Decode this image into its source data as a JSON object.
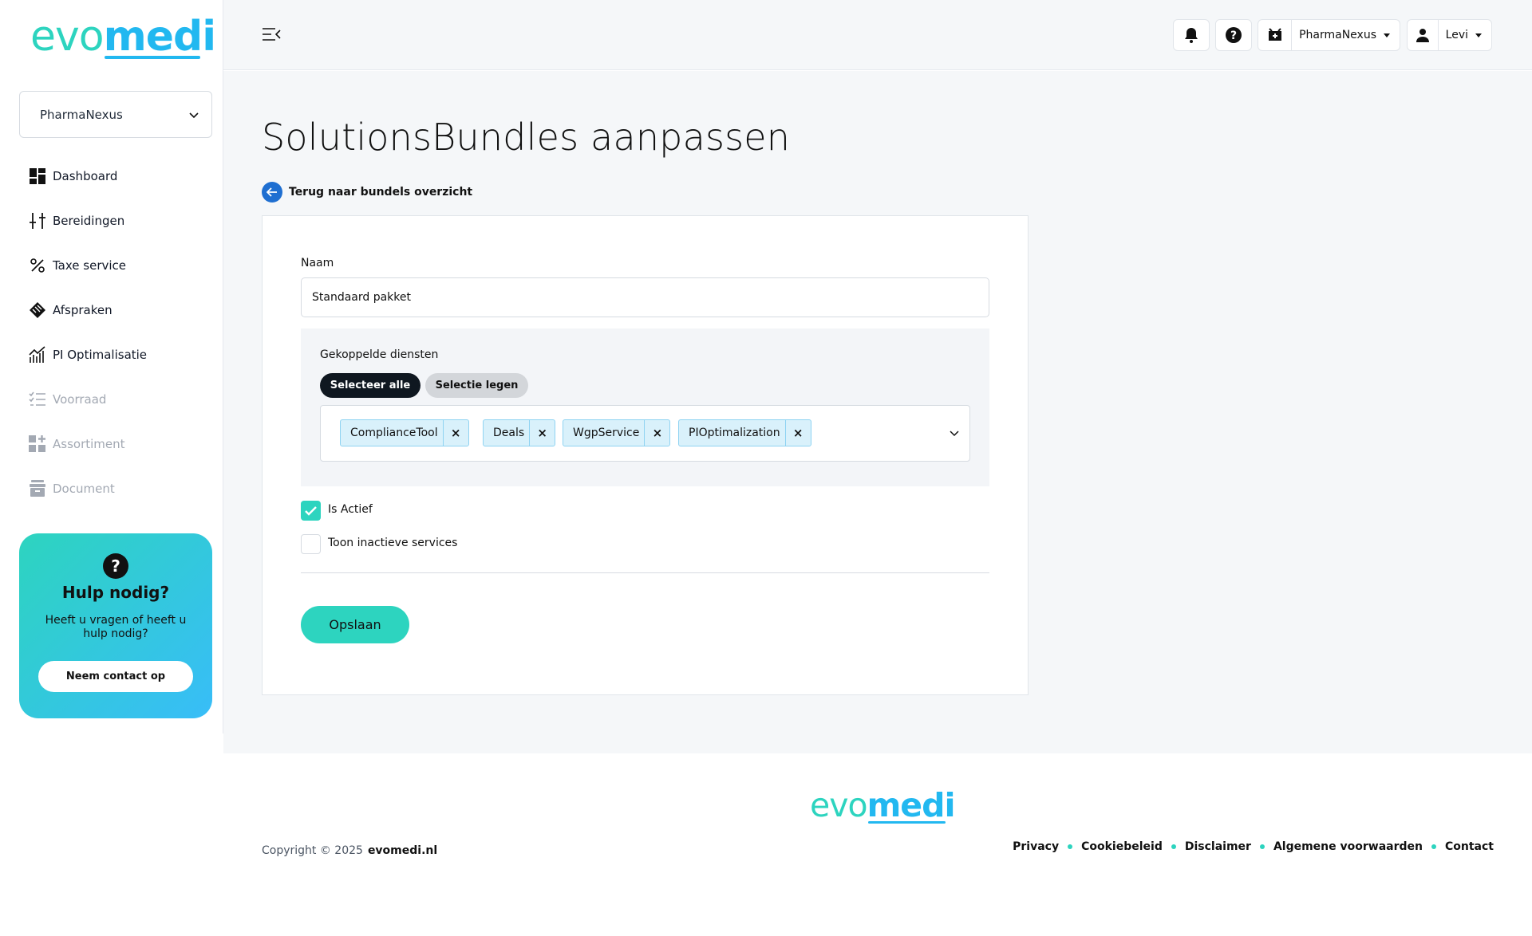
{
  "brand": {
    "logo_part1": "evo",
    "logo_part2": "medi",
    "accent_teal": "#2dd4bf",
    "accent_blue": "#22b8f0"
  },
  "sidebar": {
    "org_selector": "PharmaNexus",
    "items": [
      {
        "label": "Dashboard",
        "icon": "dashboard-icon",
        "enabled": true
      },
      {
        "label": "Bereidingen",
        "icon": "tools-icon",
        "enabled": true
      },
      {
        "label": "Taxe service",
        "icon": "percent-icon",
        "enabled": true
      },
      {
        "label": "Afspraken",
        "icon": "handshake-icon",
        "enabled": true
      },
      {
        "label": "PI Optimalisatie",
        "icon": "chart-icon",
        "enabled": true
      },
      {
        "label": "Voorraad",
        "icon": "checklist-icon",
        "enabled": false
      },
      {
        "label": "Assortiment",
        "icon": "grid-add-icon",
        "enabled": false
      },
      {
        "label": "Document",
        "icon": "archive-icon",
        "enabled": false
      }
    ],
    "help": {
      "title": "Hulp nodig?",
      "text": "Heeft u vragen of heeft u hulp nodig?",
      "button": "Neem contact op"
    }
  },
  "topbar": {
    "pharmacy": "PharmaNexus",
    "user": "Levi"
  },
  "page": {
    "title": "SolutionsBundles aanpassen",
    "back_link": "Terug naar bundels overzicht",
    "form": {
      "name_label": "Naam",
      "name_value": "Standaard pakket",
      "services_label": "Gekoppelde diensten",
      "select_all": "Selecteer alle",
      "clear_selection": "Selectie legen",
      "tags": [
        "ComplianceTool",
        "Deals",
        "WgpService",
        "PIOptimalization"
      ],
      "is_active_label": "Is Actief",
      "is_active": true,
      "show_inactive_label": "Toon inactieve services",
      "show_inactive": false,
      "save": "Opslaan"
    }
  },
  "footer": {
    "copyright": "Copyright © 2025",
    "site": "evomedi.nl",
    "links": [
      "Privacy",
      "Cookiebeleid",
      "Disclaimer",
      "Algemene voorwaarden",
      "Contact"
    ]
  }
}
